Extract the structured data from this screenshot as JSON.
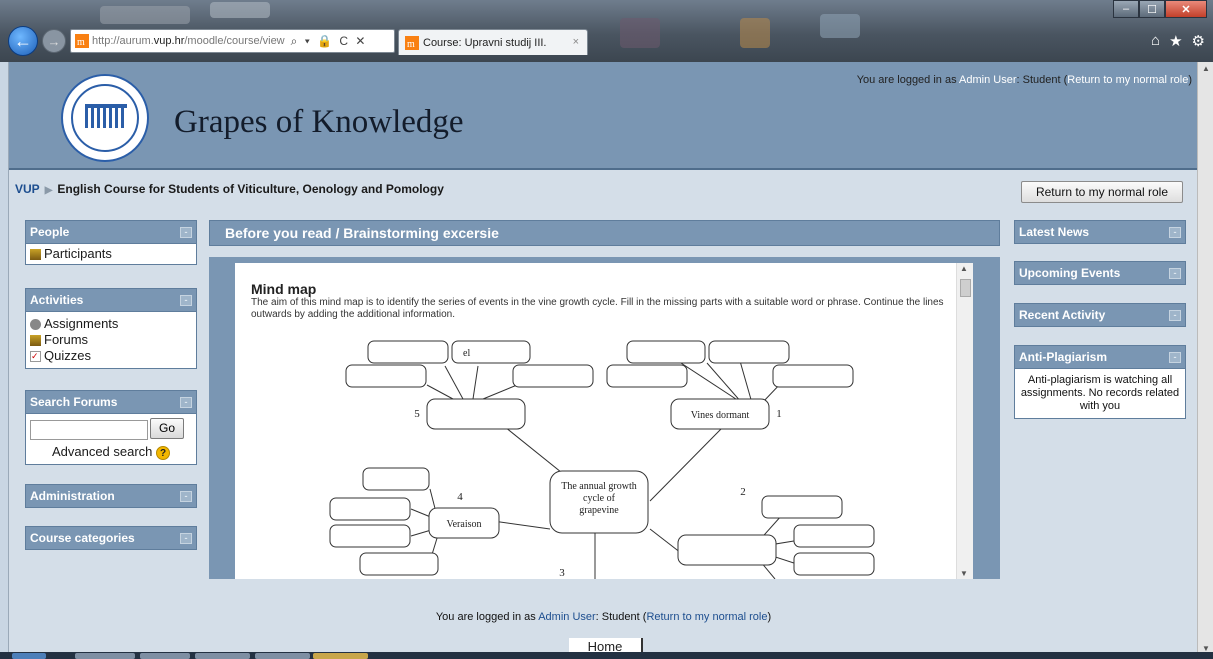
{
  "browser": {
    "url_prefix": "http://",
    "url_grey1": "aurum.",
    "url_domain": "vup.hr",
    "url_grey2": "/moodle/course/view",
    "url_icons": "⌕ ▾ 🔒 C ✕",
    "tab_title": "Course: Upravni studij III.",
    "tab_close": "×",
    "win_min": "–",
    "win_max": "☐",
    "win_close": "✕",
    "tools": [
      "⌂",
      "★",
      "⚙"
    ]
  },
  "header": {
    "site_title": "Grapes of Knowledge",
    "login_prefix": "You are logged in as ",
    "login_user": "Admin User",
    "login_role": ": Student (",
    "login_return": "Return to my normal role",
    "login_suffix": ")"
  },
  "breadcrumb": {
    "root": "VUP",
    "separator": "▶",
    "course": "English Course for Students of Viticulture, Oenology and Pomology"
  },
  "role_button": "Return to my normal role",
  "left_blocks": {
    "people": {
      "title": "People",
      "items": [
        "Participants"
      ]
    },
    "activities": {
      "title": "Activities",
      "items": [
        "Assignments",
        "Forums",
        "Quizzes"
      ]
    },
    "search": {
      "title": "Search Forums",
      "go": "Go",
      "advanced": "Advanced search",
      "help": "?"
    },
    "administration": {
      "title": "Administration"
    },
    "categories": {
      "title": "Course categories"
    }
  },
  "hide_glyph": "-",
  "center": {
    "title": "Before you read / Brainstorming excersie",
    "mind_map_title": "Mind map",
    "mind_map_text": "The aim of this mind map is to identify the series of events in the vine growth cycle. Fill in the missing parts with a suitable word or phrase. Continue the lines outwards by adding the additional information.",
    "center_label": [
      "The annual growth",
      "cycle of",
      "grapevine"
    ],
    "node_dormant": "Vines dormant",
    "node_veraison": "Veraison",
    "typed_answer": "el",
    "numbers": [
      "1",
      "2",
      "3",
      "4",
      "5"
    ]
  },
  "right_blocks": {
    "latest_news": "Latest News",
    "upcoming": "Upcoming Events",
    "recent": "Recent Activity",
    "anti_title": "Anti-Plagiarism",
    "anti_text": "Anti-plagiarism is watching all assignments. No records related with you"
  },
  "footer": {
    "prefix": "You are logged in as ",
    "user": "Admin User",
    "role": ": Student (",
    "return": "Return to my normal role",
    "suffix": ")",
    "home": "Home"
  },
  "colors": {
    "block_header": "#7a96b3",
    "page_bg": "#d4dee8",
    "link": "#1d4e8f"
  }
}
